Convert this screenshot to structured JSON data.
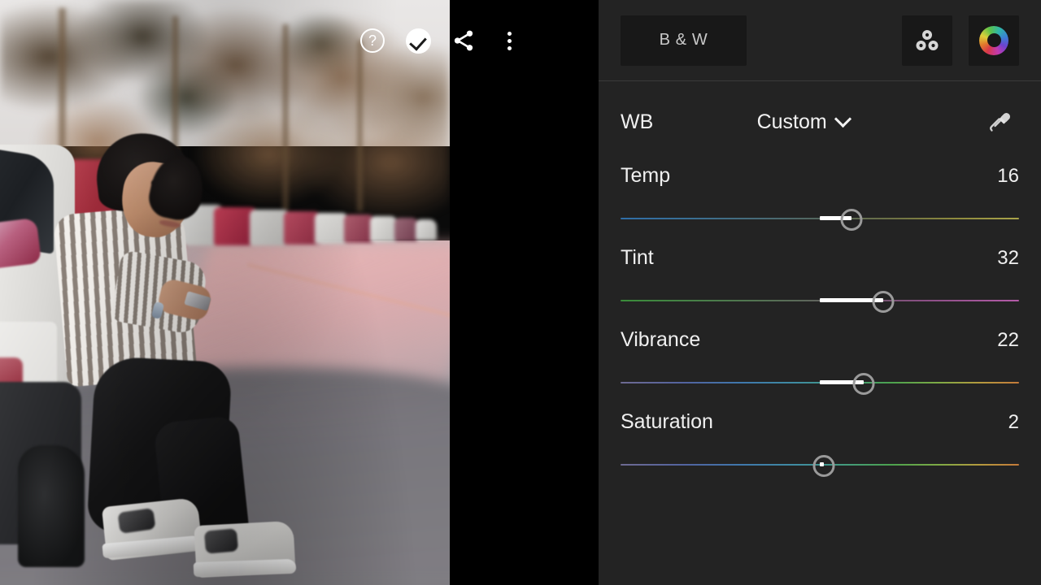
{
  "app": {
    "accent_white": "#ffffff",
    "panel_bg": "#232323",
    "control_bg": "#181818",
    "knob_color": "#9a9a9a"
  },
  "photo_overlay": {
    "icons": [
      {
        "name": "help-icon",
        "glyph": "?",
        "label": "Help"
      },
      {
        "name": "check-icon",
        "glyph": "✓",
        "label": "Apply"
      },
      {
        "name": "share-icon",
        "glyph": "➤",
        "label": "Share"
      },
      {
        "name": "more-icon",
        "glyph": "⋮",
        "label": "More options"
      }
    ]
  },
  "photo": {
    "description": "Young man in a white and grey vertical striped shirt leaning against a white SUV on a street lined with parked cars and blurred palm trees"
  },
  "panel": {
    "topbar": {
      "bw_label": "B & W",
      "color_mix_icon": "color-mix-icon",
      "color_wheel_icon": "color-wheel-icon"
    },
    "wb": {
      "label": "WB",
      "value": "Custom",
      "chevron": "chevron-down-icon",
      "eyedropper": "eyedropper-icon"
    },
    "sliders": [
      {
        "name": "Temp",
        "value": "16",
        "knob_pct": 58.0,
        "fill_start_pct": 50.0,
        "fill_end_pct": 58.0,
        "gradient_class": "grad-temp",
        "gradient_from": "#2f6ea8",
        "gradient_to": "#aaa44a"
      },
      {
        "name": "Tint",
        "value": "32",
        "knob_pct": 66.0,
        "fill_start_pct": 50.0,
        "fill_end_pct": 66.0,
        "gradient_class": "grad-tint",
        "gradient_from": "#3a8c3a",
        "gradient_to": "#b45ba8"
      },
      {
        "name": "Vibrance",
        "value": "22",
        "knob_pct": 61.0,
        "fill_start_pct": 50.0,
        "fill_end_pct": 61.0,
        "gradient_class": "grad-vib",
        "gradient_from": "#6e6a92",
        "gradient_to": "#c47a3a"
      },
      {
        "name": "Saturation",
        "value": "2",
        "knob_pct": 51.0,
        "fill_start_pct": 50.0,
        "fill_end_pct": 51.0,
        "gradient_class": "grad-sat",
        "gradient_from": "#6e6a92",
        "gradient_to": "#c47a3a"
      }
    ]
  }
}
